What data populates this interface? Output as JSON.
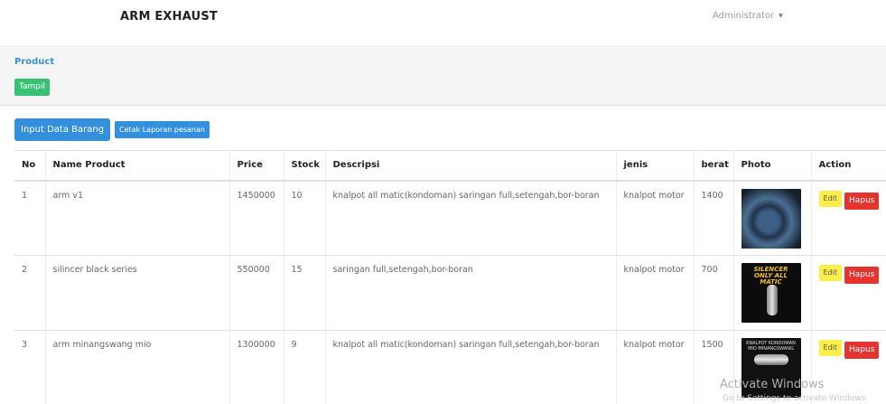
{
  "header": {
    "brand": "ARM EXHAUST",
    "user": "Administrator"
  },
  "panel": {
    "title": "Product",
    "tampil_label": "Tampil"
  },
  "toolbar": {
    "input_label": "Input Data Barang",
    "cetak_label": "Cetak Laporan pesanan"
  },
  "table": {
    "columns": [
      "No",
      "Name Product",
      "Price",
      "Stock",
      "Descripsi",
      "jenis",
      "berat",
      "Photo",
      "Action"
    ],
    "rows": [
      {
        "no": "1",
        "name": "arm v1",
        "price": "1450000",
        "stock": "10",
        "desc": "knalpot all matic(kondoman) saringan full,setengah,bor-boran",
        "jenis": "knalpot motor",
        "berat": "1400",
        "photo_text": "",
        "edit_label": "Edit",
        "hapus_label": "Hapus"
      },
      {
        "no": "2",
        "name": "silincer black series",
        "price": "550000",
        "stock": "15",
        "desc": "saringan full,setengah,bor-boran",
        "jenis": "knalpot motor",
        "berat": "700",
        "photo_text": "SILENCER ONLY ALL MATIC",
        "edit_label": "Edit",
        "hapus_label": "Hapus"
      },
      {
        "no": "3",
        "name": "arm minangswang mio",
        "price": "1300000",
        "stock": "9",
        "desc": "knalpot all matic(kondoman) saringan full,setengah,bor-boran",
        "jenis": "knalpot motor",
        "berat": "1500",
        "photo_text": "KNALPOT KONDOMAN MIO MINANGSWANG",
        "edit_label": "Edit",
        "hapus_label": "Hapus"
      }
    ]
  },
  "watermark": {
    "title": "Activate Windows",
    "sub": "Go to Settings to activate Windows."
  },
  "colors": {
    "primary": "#3490dc",
    "success": "#38c172",
    "warning": "#ffed4a",
    "danger": "#e3342f",
    "panel_bg": "#f5f5f5"
  }
}
